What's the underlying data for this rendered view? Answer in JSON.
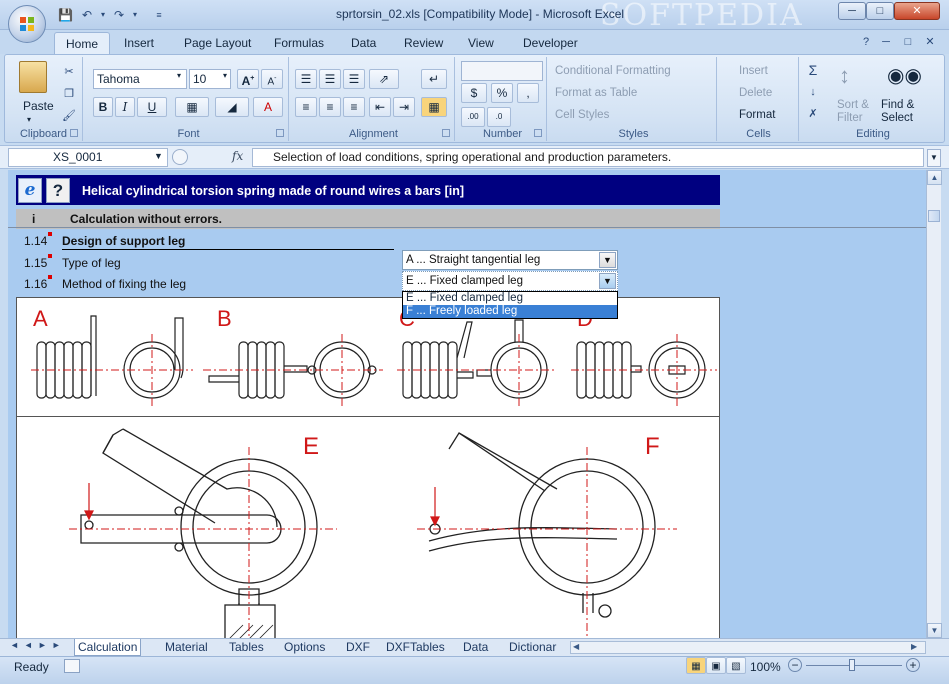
{
  "window": {
    "title": "sprtorsin_02.xls  [Compatibility Mode] - Microsoft Excel",
    "watermark": "SOFTPEDIA"
  },
  "tabs": [
    "Home",
    "Insert",
    "Page Layout",
    "Formulas",
    "Data",
    "Review",
    "View",
    "Developer"
  ],
  "ribbon": {
    "clipboard": {
      "paste": "Paste",
      "label": "Clipboard"
    },
    "font": {
      "name": "Tahoma",
      "size": "10",
      "label": "Font"
    },
    "alignment": {
      "label": "Alignment"
    },
    "number": {
      "label": "Number"
    },
    "styles": {
      "conditional": "Conditional Formatting",
      "table": "Format as Table",
      "cell": "Cell Styles",
      "label": "Styles"
    },
    "cells": {
      "insert": "Insert",
      "delete": "Delete",
      "format": "Format",
      "label": "Cells"
    },
    "editing": {
      "sort": "Sort &",
      "sort2": "Filter",
      "find": "Find &",
      "find2": "Select",
      "label": "Editing"
    }
  },
  "formula_bar": {
    "name_box": "XS_0001",
    "fx": "fx",
    "content": "Selection of load conditions, spring operational and production parameters."
  },
  "sheet": {
    "title": "Helical cylindrical torsion spring made of round wires a bars [in]",
    "status_label": "i",
    "status_text": "Calculation without errors.",
    "rows": [
      {
        "num": "1.14",
        "label": "Design of support leg"
      },
      {
        "num": "1.15",
        "label": "Type of leg"
      },
      {
        "num": "1.16",
        "label": "Method of fixing the leg"
      }
    ],
    "dropdown_leg_type": "A ... Straight tangential leg",
    "dropdown_fixing": "E ... Fixed clamped leg",
    "dropdown_options": [
      "E ... Fixed clamped leg",
      "F ... Freely loaded leg"
    ],
    "diagram_labels": [
      "A",
      "B",
      "C",
      "D",
      "E",
      "F"
    ]
  },
  "sheet_tabs": [
    "Calculation",
    "Material",
    "Tables",
    "Options",
    "DXF",
    "DXFTables",
    "Data",
    "Dictionar"
  ],
  "status": {
    "ready": "Ready",
    "zoom": "100%"
  },
  "colors": {
    "title_band": "#000080",
    "sheet_bg": "#a9cbf0",
    "drawing_red": "#d01818"
  }
}
